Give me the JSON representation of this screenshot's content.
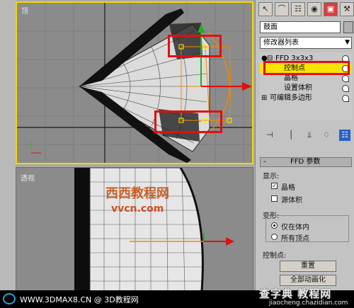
{
  "viewports": {
    "top": {
      "label": "顶"
    },
    "persp": {
      "label": "透视",
      "watermark_main": "西西教程网",
      "watermark_url": "vvcn.com"
    }
  },
  "panel": {
    "object_name": "鼓面",
    "modifier_list": "修改器列表",
    "stack": {
      "ffd": "FFD 3x3x3",
      "control_points": "控制点",
      "lattice": "晶格",
      "set_volume": "设置体积",
      "editable_poly": "可编辑多边形"
    },
    "rollout": {
      "title": "FFD 参数",
      "display_label": "显示:",
      "lattice_label": "晶格",
      "lattice_checked": true,
      "source_volume_label": "源体积",
      "source_volume_checked": false,
      "deform_label": "变形:",
      "only_in_volume_label": "仅在体内",
      "all_vertices_label": "所有顶点",
      "control_points_label": "控制点:",
      "reset_button": "重置",
      "animate_all_button": "全部动画化"
    }
  },
  "footer": {
    "text": "WWW.3DMAX8.CN @ 3D教程网",
    "watermark_cn": "查字典 教程网",
    "watermark_url": "jiaocheng.chazidian.com"
  },
  "colors": {
    "selection_yellow": "#f6e300",
    "highlight_red": "#e01010",
    "gizmo_orange": "#f08a00"
  }
}
